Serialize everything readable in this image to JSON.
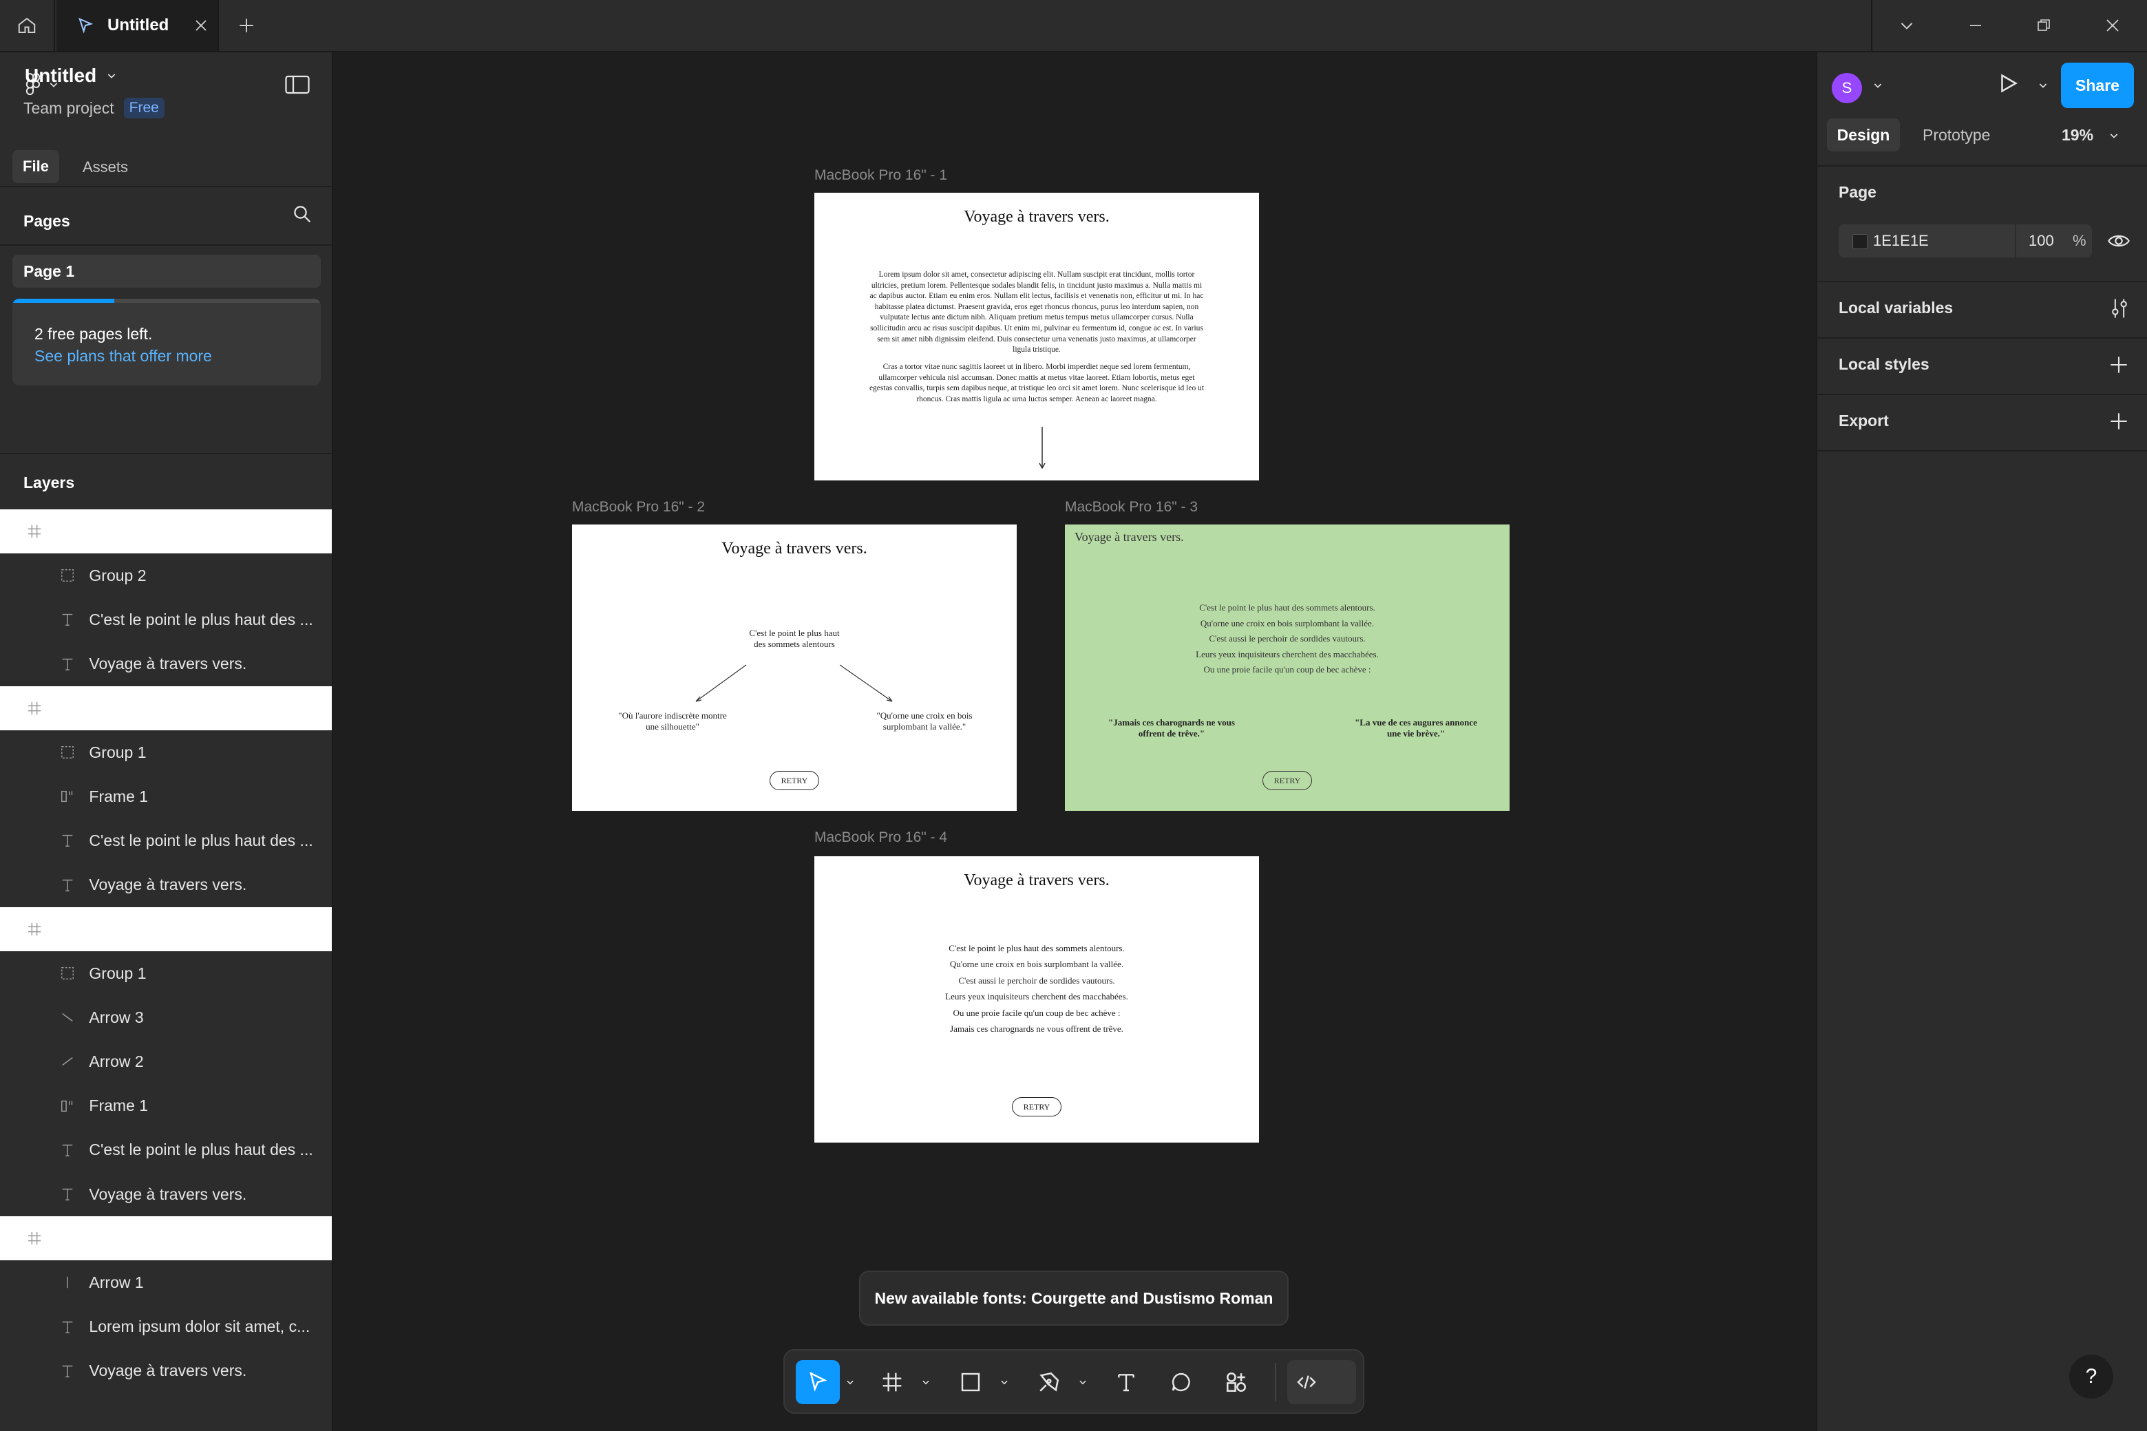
{
  "window": {
    "tab_title": "Untitled"
  },
  "left_panel": {
    "file_name": "Untitled",
    "team": "Team project",
    "plan_badge": "Free",
    "tabs": {
      "file": "File",
      "assets": "Assets"
    },
    "pages_heading": "Pages",
    "pages": [
      "Page 1"
    ],
    "upsell": {
      "text": "2 free pages left.",
      "link": "See plans that offer more",
      "progress": 0.33
    },
    "layers_heading": "Layers",
    "layers": [
      {
        "type": "frame",
        "name": "MacBook Pro 16\" - 4"
      },
      {
        "type": "group",
        "name": "Group 2"
      },
      {
        "type": "text",
        "name": "C'est le point le plus haut des ..."
      },
      {
        "type": "text",
        "name": "Voyage à travers vers."
      },
      {
        "type": "frame",
        "name": "MacBook Pro 16\" - 3"
      },
      {
        "type": "group",
        "name": "Group 1"
      },
      {
        "type": "autolayout",
        "name": "Frame 1"
      },
      {
        "type": "text",
        "name": "C'est le point le plus haut des ..."
      },
      {
        "type": "text",
        "name": "Voyage à travers vers."
      },
      {
        "type": "frame",
        "name": "MacBook Pro 16\" - 2"
      },
      {
        "type": "group",
        "name": "Group 1"
      },
      {
        "type": "arrow-down",
        "name": "Arrow 3"
      },
      {
        "type": "arrow-up",
        "name": "Arrow 2"
      },
      {
        "type": "autolayout",
        "name": "Frame 1"
      },
      {
        "type": "text",
        "name": "C'est le point le plus haut des ..."
      },
      {
        "type": "text",
        "name": "Voyage à travers vers."
      },
      {
        "type": "frame",
        "name": "MacBook Pro 16\" - 1"
      },
      {
        "type": "line",
        "name": "Arrow 1"
      },
      {
        "type": "text",
        "name": "Lorem ipsum dolor sit amet, c..."
      },
      {
        "type": "text",
        "name": "Voyage à travers vers."
      }
    ]
  },
  "canvas": {
    "frames": {
      "f1": {
        "label": "MacBook Pro 16\" - 1",
        "title": "Voyage à travers vers.",
        "para1": "Lorem ipsum dolor sit amet, consectetur adipiscing elit. Nullam suscipit erat tincidunt, mollis tortor ultricies, pretium lorem. Pellentesque sodales blandit felis, in tincidunt justo maximus a. Nulla mattis mi ac dapibus auctor. Etiam eu enim eros. Nullam elit lectus, facilisis et venenatis non, efficitur ut mi. In hac habitasse platea dictumst. Praesent gravida, eros eget rhoncus rhoncus, purus leo interdum sapien, non vulputate lectus ante dictum nibh. Aliquam pretium metus tempus metus ullamcorper cursus. Nulla sollicitudin arcu ac risus suscipit dapibus. Ut enim mi, pulvinar eu fermentum id, congue ac est. In varius sem sit amet nibh dignissim eleifend. Duis consectetur urna venenatis justo maximus, at ullamcorper ligula tristique.",
        "para2": "Cras a tortor vitae nunc sagittis laoreet ut in libero. Morbi imperdiet neque sed lorem fermentum, ullamcorper vehicula nisl accumsan. Donec mattis at metus vitae laoreet. Etiam lobortis, metus eget egestas convallis, turpis sem dapibus neque, at tristique leo orci sit amet lorem. Nunc scelerisque id leo ut rhoncus. Cras mattis ligula ac urna luctus semper. Aenean ac laoreet magna."
      },
      "f2": {
        "label": "MacBook Pro 16\" - 2",
        "title": "Voyage à travers vers.",
        "center": [
          "C'est le point le plus haut",
          "des sommets alentours"
        ],
        "left": [
          "\"Où l'aurore indiscrète montre",
          "une silhouette\""
        ],
        "right": [
          "\"Qu'orne une croix en bois",
          "surplombant la vallée.\""
        ],
        "retry": "RETRY"
      },
      "f3": {
        "label": "MacBook Pro 16\" - 3",
        "title": "Voyage à travers vers.",
        "bg": "#b7dba5",
        "lines": [
          "C'est le point le plus haut des sommets alentours.",
          "Qu'orne une croix en bois surplombant la vallée.",
          "C'est aussi le perchoir de sordides vautours.",
          "Leurs yeux inquisiteurs cherchent des macchabées.",
          "Ou une proie facile qu'un coup de bec achève :"
        ],
        "left": [
          "\"Jamais ces charognards ne vous",
          "offrent de trêve.\""
        ],
        "right": [
          "\"La vue de ces augures annonce",
          "une vie brève.\""
        ],
        "retry": "RETRY"
      },
      "f4": {
        "label": "MacBook Pro 16\" - 4",
        "title": "Voyage à travers vers.",
        "lines": [
          "C'est le point le plus haut des sommets alentours.",
          "Qu'orne une croix en bois surplombant la vallée.",
          "C'est aussi le perchoir de sordides vautours.",
          "Leurs yeux inquisiteurs cherchent des macchabées.",
          "Ou une proie facile qu'un coup de bec achève :",
          "Jamais ces charognards ne vous offrent de trêve."
        ],
        "retry": "RETRY"
      }
    }
  },
  "right_panel": {
    "avatar_initial": "S",
    "share": "Share",
    "tabs": {
      "design": "Design",
      "prototype": "Prototype"
    },
    "zoom": "19%",
    "page_heading": "Page",
    "page_color_hex": "1E1E1E",
    "page_color": "#1e1e1e",
    "page_opacity": "100",
    "percent_sign": "%",
    "sections": [
      "Local variables",
      "Local styles",
      "Export"
    ]
  },
  "toast": "New available fonts: Courgette and Dustismo Roman",
  "colors": {
    "accent": "#0d99ff",
    "panel": "#2c2c2c",
    "canvas": "#1e1e1e"
  }
}
